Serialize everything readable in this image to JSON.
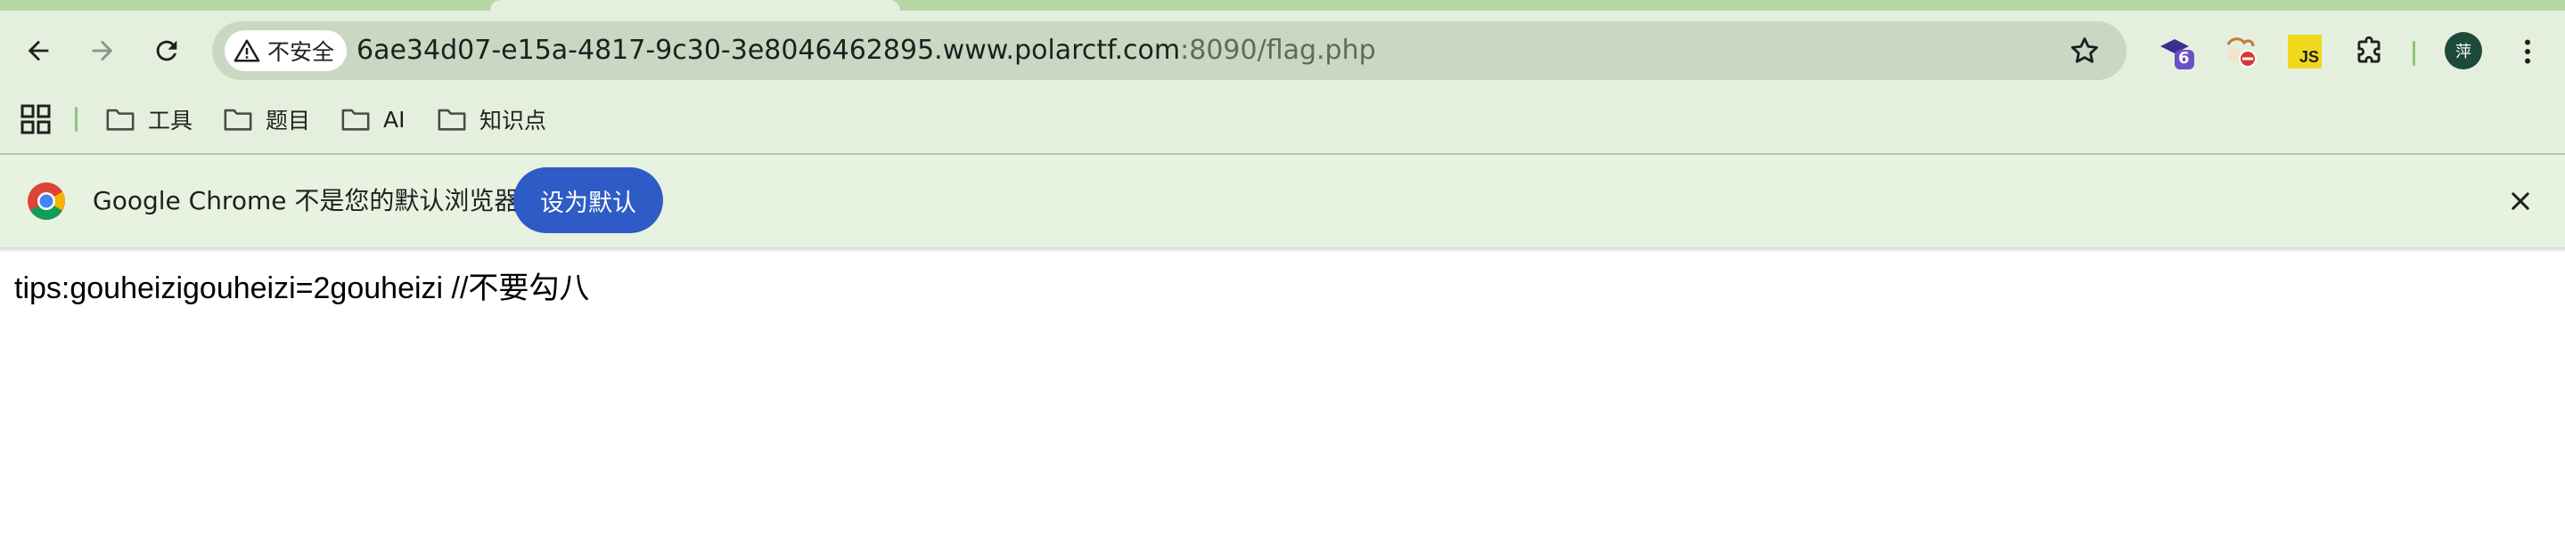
{
  "browser": {
    "security_label": "不安全",
    "url_host": "6ae34d07-e15a-4817-9c30-3e8046462895.www.polarctf.com",
    "url_rest": ":8090/flag.php",
    "extensions": [
      {
        "name": "extension-badge",
        "badge": "6"
      },
      {
        "name": "extension-blocked"
      },
      {
        "name": "extension-js",
        "label": "JS"
      }
    ],
    "profile_initial": "萍"
  },
  "bookmarks": [
    {
      "label": "工具"
    },
    {
      "label": "题目"
    },
    {
      "label": "AI"
    },
    {
      "label": "知识点"
    }
  ],
  "infobar": {
    "message": "Google Chrome 不是您的默认浏览器",
    "button_label": "设为默认"
  },
  "page": {
    "text": "tips:gouheizigouheizi=2gouheizi //不要勾八"
  },
  "colors": {
    "chrome_bg": "#e4f0dd",
    "omnibox_bg": "#c8d8c2",
    "button_blue": "#2f5bc6",
    "profile_bg": "#1d4a3a"
  }
}
